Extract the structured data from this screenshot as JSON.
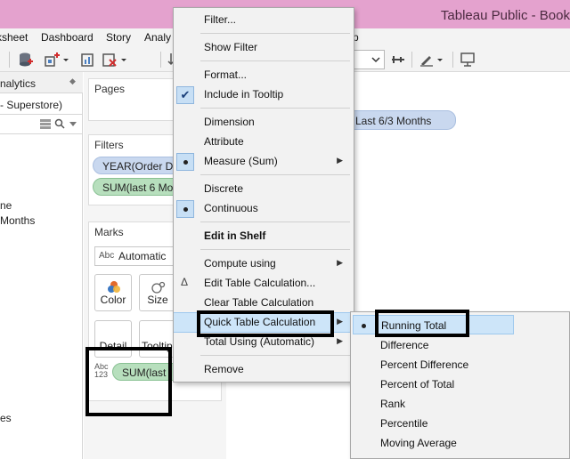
{
  "title_bar": {
    "title": "Tableau Public - Book"
  },
  "menu_bar": {
    "items": [
      "ksheet",
      "Dashboard",
      "Story",
      "Analy",
      "p"
    ]
  },
  "toolbar": {
    "dropdown_value": ""
  },
  "left_pane": {
    "tab_label": "nalytics",
    "data_source": "- Superstore)",
    "fields": [
      "ne",
      "Months",
      "es"
    ]
  },
  "shelves": {
    "pages_title": "Pages",
    "filters_title": "Filters",
    "filter_pills": [
      "YEAR(Order Da",
      "SUM(last 6 Mo"
    ],
    "marks_title": "Marks",
    "mark_type": "Automatic",
    "mark_type_abbrev": "Abc",
    "mark_buttons": [
      "Color",
      "Size",
      "Detail",
      "Tooltip"
    ],
    "text_icon": [
      "Abc",
      "123"
    ],
    "measure_pill": "SUM(last"
  },
  "view": {
    "pill": "Last 6/3 Months"
  },
  "context_menu": {
    "items": [
      {
        "label": "Filter...",
        "state": ""
      },
      {
        "label": "Show Filter",
        "state": ""
      },
      {
        "label": "Format...",
        "state": ""
      },
      {
        "label": "Include in Tooltip",
        "state": "checked"
      },
      {
        "label": "Dimension",
        "state": ""
      },
      {
        "label": "Attribute",
        "state": ""
      },
      {
        "label": "Measure (Sum)",
        "state": "selected"
      },
      {
        "label": "Discrete",
        "state": ""
      },
      {
        "label": "Continuous",
        "state": "selected"
      },
      {
        "label": "Edit in Shelf",
        "state": ""
      },
      {
        "label": "Compute using",
        "state": ""
      },
      {
        "label": "Edit Table Calculation...",
        "state": "delta"
      },
      {
        "label": "Clear Table Calculation",
        "state": ""
      },
      {
        "label": "Quick Table Calculation",
        "state": "highlighted"
      },
      {
        "label": "Total Using (Automatic)",
        "state": ""
      },
      {
        "label": "Remove",
        "state": ""
      }
    ],
    "delta_glyph": "Δ"
  },
  "submenu": {
    "items": [
      {
        "label": "Running Total",
        "state": "selected"
      },
      {
        "label": "Difference",
        "state": ""
      },
      {
        "label": "Percent Difference",
        "state": ""
      },
      {
        "label": "Percent of Total",
        "state": ""
      },
      {
        "label": "Rank",
        "state": ""
      },
      {
        "label": "Percentile",
        "state": ""
      },
      {
        "label": "Moving Average",
        "state": ""
      }
    ]
  },
  "colors": {
    "title_bar": "#e4a2ce",
    "highlight": "#cde5f9",
    "pill_blue": "#c9d8ef",
    "pill_green": "#b7dfbd"
  }
}
